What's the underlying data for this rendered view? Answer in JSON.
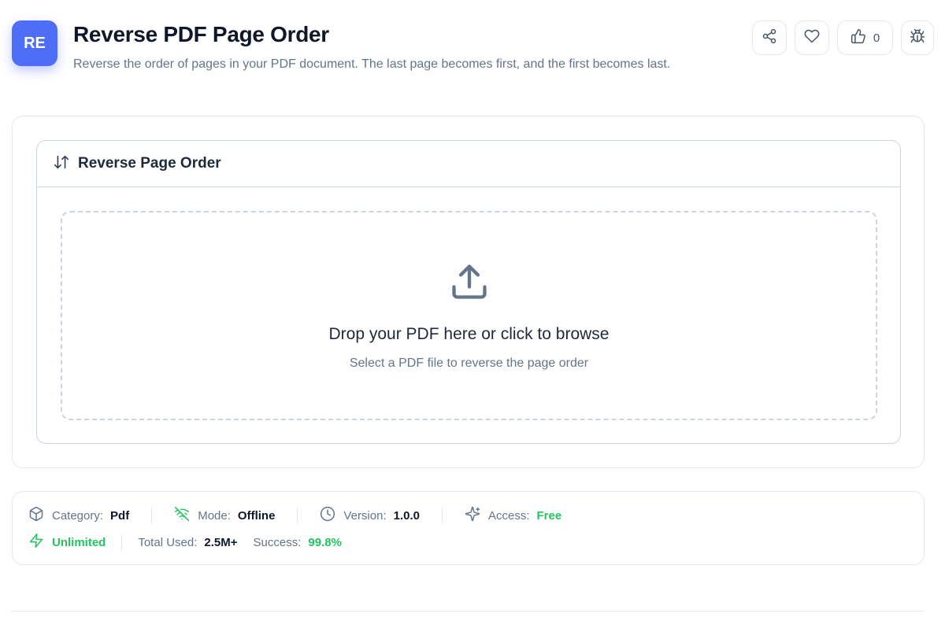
{
  "header": {
    "logo_text": "RE",
    "title": "Reverse PDF Page Order",
    "subtitle": "Reverse the order of pages in your PDF document. The last page becomes first, and the first becomes last."
  },
  "actions": {
    "like_count": "0",
    "icons": [
      "share-icon",
      "heart-icon",
      "thumbs-up-icon",
      "bug-icon"
    ]
  },
  "tool": {
    "heading": "Reverse Page Order",
    "dropzone": {
      "title": "Drop your PDF here or click to browse",
      "subtitle": "Select a PDF file to reverse the page order"
    }
  },
  "info": {
    "category_label": "Category:",
    "category_value": "Pdf",
    "mode_label": "Mode:",
    "mode_value": "Offline",
    "version_label": "Version:",
    "version_value": "1.0.0",
    "access_label": "Access:",
    "access_value": "Free",
    "unlimited": "Unlimited",
    "total_used_label": "Total Used:",
    "total_used_value": "2.5M+",
    "success_label": "Success:",
    "success_value": "99.8%"
  },
  "colors": {
    "accent": "#4f6ef7",
    "success": "#22c55e",
    "muted": "#64748b"
  }
}
